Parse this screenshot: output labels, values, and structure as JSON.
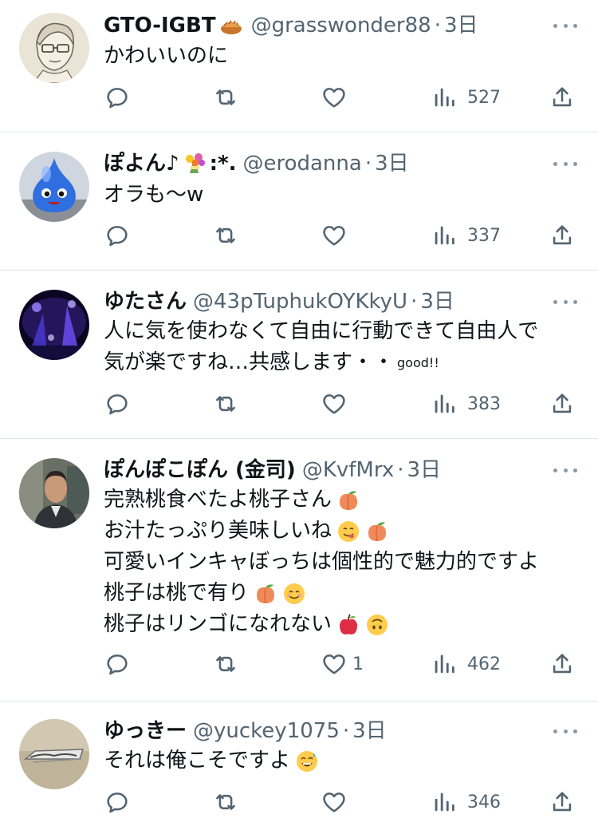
{
  "tweets": [
    {
      "display_name": "GTO-IGBT",
      "name_emoji": "pie-emoji",
      "handle": "@grasswonder88",
      "separator": "·",
      "time": "3日",
      "lines": [
        "かわいいのに"
      ],
      "replies": "",
      "retweets": "",
      "likes": "",
      "views": "527",
      "avatar": "sketch-portrait-avatar"
    },
    {
      "display_name": "ぽよん♪",
      "name_suffix": ":*.",
      "name_emoji": "flower-bouquet-emoji",
      "handle": "@erodanna",
      "separator": "·",
      "time": "3日",
      "lines": [
        "オラも〜w"
      ],
      "replies": "",
      "retweets": "",
      "likes": "",
      "views": "337",
      "avatar": "blue-slime-avatar"
    },
    {
      "display_name": "ゆたさん",
      "handle": "@43pTuphukOYKkyU",
      "separator": "·",
      "time": "3日",
      "lines": [
        "人に気を使わなくて自由に行動できて自由人で",
        "気が楽ですね…共感します・・"
      ],
      "line2_small": "good!!",
      "replies": "",
      "retweets": "",
      "likes": "",
      "views": "383",
      "avatar": "night-illumination-avatar"
    },
    {
      "display_name": "ぽんぽこぽん (金司)",
      "handle": "@KvfMrx",
      "separator": "·",
      "time": "3日",
      "lines": [
        "完熟桃食べたよ桃子さん",
        "お汁たっぷり美味しいね",
        "可愛いインキャぼっちは個性的で魅力的ですよ",
        "桃子は桃で有り",
        "桃子はリンゴになれない"
      ],
      "line_emojis": [
        [
          "peach-emoji"
        ],
        [
          "yum-face-emoji",
          "peach-emoji"
        ],
        [],
        [
          "peach-emoji",
          "smiling-face-emoji"
        ],
        [
          "red-apple-emoji",
          "upside-down-face-emoji"
        ]
      ],
      "replies": "",
      "retweets": "",
      "likes": "1",
      "views": "462",
      "avatar": "man-photo-avatar"
    },
    {
      "display_name": "ゆっきー",
      "handle": "@yuckey1075",
      "separator": "·",
      "time": "3日",
      "lines": [
        "それは俺こそですよ"
      ],
      "line_emojis": [
        [
          "sweat-smile-emoji"
        ]
      ],
      "replies": "",
      "retweets": "",
      "likes": "",
      "views": "346",
      "avatar": "car-emblem-avatar"
    }
  ],
  "colors": {
    "text": "#0f1419",
    "secondary": "#536471",
    "divider": "#e1e6ea",
    "background": "#ffffff"
  }
}
